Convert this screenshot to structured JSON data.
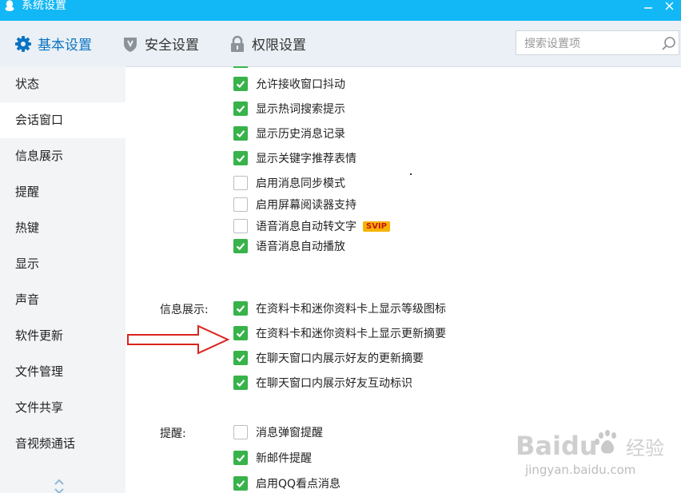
{
  "window": {
    "title": "系统设置",
    "minimize_icon": "minimize-icon",
    "close_icon": "close-icon"
  },
  "tabs": [
    {
      "label": "基本设置",
      "icon": "gear-icon",
      "active": true
    },
    {
      "label": "安全设置",
      "icon": "shield-icon",
      "active": false
    },
    {
      "label": "权限设置",
      "icon": "lock-icon",
      "active": false
    }
  ],
  "search": {
    "placeholder": "搜索设置项",
    "icon": "search-icon"
  },
  "sidebar": {
    "items": [
      {
        "label": "状态"
      },
      {
        "label": "会话窗口",
        "active": true
      },
      {
        "label": "信息展示"
      },
      {
        "label": "提醒"
      },
      {
        "label": "热键"
      },
      {
        "label": "显示"
      },
      {
        "label": "声音"
      },
      {
        "label": "软件更新"
      },
      {
        "label": "文件管理"
      },
      {
        "label": "文件共享"
      },
      {
        "label": "音视频通话"
      }
    ]
  },
  "session_options": [
    {
      "label": "允许接收窗口抖动",
      "checked": true
    },
    {
      "label": "显示热词搜索提示",
      "checked": true
    },
    {
      "label": "显示历史消息记录",
      "checked": true
    },
    {
      "label": "显示关键字推荐表情",
      "checked": true
    },
    {
      "label": "启用消息同步模式",
      "checked": false
    },
    {
      "label": "启用屏幕阅读器支持",
      "checked": false
    },
    {
      "label": "语音消息自动转文字",
      "checked": false,
      "badge": "SVIP"
    },
    {
      "label": "语音消息自动播放",
      "checked": true
    }
  ],
  "info_section": {
    "label": "信息展示:",
    "options": [
      {
        "label": "在资料卡和迷你资料卡上显示等级图标",
        "checked": true
      },
      {
        "label": "在资料卡和迷你资料卡上显示更新摘要",
        "checked": true
      },
      {
        "label": "在聊天窗口内展示好友的更新摘要",
        "checked": true
      },
      {
        "label": "在聊天窗口内展示好友互动标识",
        "checked": true
      }
    ]
  },
  "remind_section": {
    "label": "提醒:",
    "options": [
      {
        "label": "消息弹窗提醒",
        "checked": false
      },
      {
        "label": "新邮件提醒",
        "checked": true
      },
      {
        "label": "启用QQ看点消息",
        "checked": true
      }
    ]
  },
  "watermark": {
    "brand": "Baidu",
    "brand_suffix": "经验",
    "url": "jingyan.baidu.com"
  },
  "colors": {
    "titlebar": "#12b7f5",
    "checkbox_on": "#37b34a",
    "accent": "#0a73c4",
    "arrow": "#d9241c",
    "badge": "#f7b300"
  }
}
